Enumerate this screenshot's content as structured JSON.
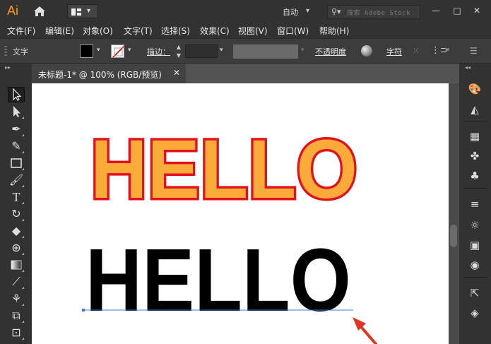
{
  "app": {
    "logo_text": "Ai"
  },
  "titlebar": {
    "workspace": "自动",
    "stock_search_placeholder": "搜索 Adobe Stock",
    "window_buttons": {
      "minimize": "—",
      "restore": "□",
      "close": "✕"
    }
  },
  "menu": [
    "文件(F)",
    "编辑(E)",
    "对象(O)",
    "文字(T)",
    "选择(S)",
    "效果(C)",
    "视图(V)",
    "窗口(W)",
    "帮助(H)"
  ],
  "control": {
    "context_label": "文字",
    "stroke_label": "描边：",
    "opacity_label": "不透明度",
    "character_label": "字符",
    "fill_color": "#000000",
    "stroke_color": "none"
  },
  "document": {
    "tab_label": "未标题-1* @ 100% (RGB/预览)",
    "close_glyph": "✕"
  },
  "artwork": {
    "text_top": "HELLO",
    "text_bottom": "HELLO",
    "top_fill": "#fbab3a",
    "top_stroke": "#e3111e",
    "bottom_fill": "#000000",
    "baseline_color": "#3e7bd6",
    "arrow_color": "#e03524"
  },
  "tools": [
    "selection-tool-icon",
    "direct-selection-tool-icon",
    "pen-tool-icon",
    "curvature-tool-icon",
    "rectangle-tool-icon",
    "paintbrush-tool-icon",
    "type-tool-icon",
    "rotate-tool-icon",
    "eraser-tool-icon",
    "shape-builder-tool-icon",
    "gradient-tool-icon",
    "eyedropper-tool-icon",
    "blend-tool-icon",
    "symbol-sprayer-tool-icon",
    "artboard-tool-icon"
  ],
  "dock": [
    "color-panel-icon",
    "color-guide-icon",
    "swatches-icon",
    "brushes-icon",
    "symbols-icon",
    "stroke-panel-icon",
    "appearance-icon",
    "gradient-panel-icon",
    "transparency-icon",
    "export-icon",
    "layers-icon"
  ]
}
